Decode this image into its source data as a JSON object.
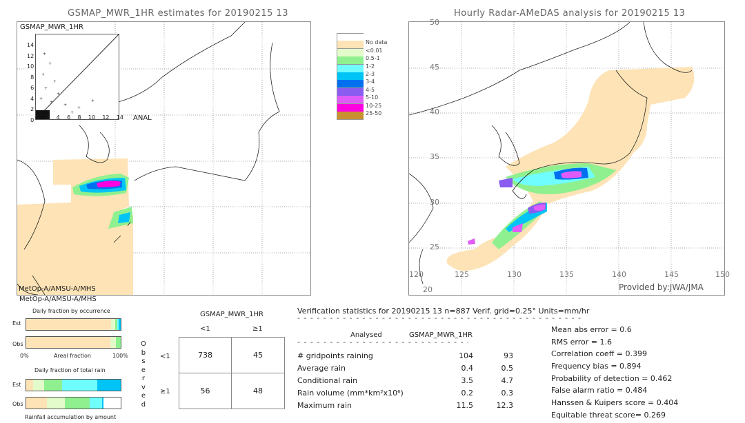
{
  "left_map": {
    "title": "GSMAP_MWR_1HR estimates for 20190215 13",
    "inset_label": "GSMAP_MWR_1HR",
    "inset_xlabel": "ANAL",
    "inset_yticks": [
      "14",
      "12",
      "10",
      "8",
      "6",
      "4",
      "2",
      "0"
    ],
    "inset_xticks": [
      "0",
      "2",
      "4",
      "6",
      "8",
      "10",
      "12",
      "14"
    ],
    "satellite": "MetOp-A/AMSU-A/MHS"
  },
  "right_map": {
    "title": "Hourly Radar-AMeDAS analysis for 20190215 13",
    "lat_ticks": [
      "50",
      "45",
      "40",
      "35",
      "30",
      "25",
      "20"
    ],
    "lon_ticks": [
      "120",
      "125",
      "130",
      "135",
      "140",
      "145",
      "150"
    ],
    "credit": "Provided by:JWA/JMA"
  },
  "legend": {
    "items": [
      {
        "label": "",
        "color": "#ffffff"
      },
      {
        "label": "No data",
        "color": "#fde3b5"
      },
      {
        "label": "<0.01",
        "color": "#e3fbcb"
      },
      {
        "label": "0.5-1",
        "color": "#8ff08f"
      },
      {
        "label": "1-2",
        "color": "#6ffdfd"
      },
      {
        "label": "2-3",
        "color": "#00c4f5"
      },
      {
        "label": "3-4",
        "color": "#0070f0"
      },
      {
        "label": "4-5",
        "color": "#8a5cf0"
      },
      {
        "label": "5-10",
        "color": "#e05cf8"
      },
      {
        "label": "10-25",
        "color": "#ff00e0"
      },
      {
        "label": "25-50",
        "color": "#c89030"
      }
    ]
  },
  "fractions": {
    "satellite": "MetOp-A/AMSU-A/MHS",
    "occurrence_title": "Daily fraction by occurrence",
    "est": "Est",
    "obs": "Obs",
    "axis_left": "0%",
    "axis_mid": "Areal fraction",
    "axis_right": "100%",
    "rain_title": "Daily fraction of total rain",
    "rain_footer": "Rainfall accumulation by amount",
    "occ_est": [
      {
        "c": "#fde3b5",
        "v": 90
      },
      {
        "c": "#e3fbcb",
        "v": 4
      },
      {
        "c": "#8ff08f",
        "v": 2
      },
      {
        "c": "#6ffdfd",
        "v": 2
      },
      {
        "c": "#00c4f5",
        "v": 2
      }
    ],
    "occ_obs": [
      {
        "c": "#fde3b5",
        "v": 89
      },
      {
        "c": "#e3fbcb",
        "v": 6
      },
      {
        "c": "#8ff08f",
        "v": 5
      }
    ],
    "rain_est": [
      {
        "c": "#fde3b5",
        "v": 7
      },
      {
        "c": "#e3fbcb",
        "v": 12
      },
      {
        "c": "#8ff08f",
        "v": 19
      },
      {
        "c": "#6ffdfd",
        "v": 37
      },
      {
        "c": "#00c4f5",
        "v": 25
      }
    ],
    "rain_obs": [
      {
        "c": "#fde3b5",
        "v": 22
      },
      {
        "c": "#e3fbcb",
        "v": 19
      },
      {
        "c": "#8ff08f",
        "v": 26
      },
      {
        "c": "#6ffdfd",
        "v": 13
      },
      {
        "c": "#00c4f5",
        "v": 2
      }
    ]
  },
  "contingency": {
    "title": "GSMAP_MWR_1HR",
    "col_lt": "<1",
    "col_ge": "≥1",
    "row_lt": "<1",
    "row_ge": "≥1",
    "observed": [
      "O",
      "b",
      "s",
      "e",
      "r",
      "v",
      "e",
      "d"
    ],
    "cells": [
      [
        "738",
        "45"
      ],
      [
        "56",
        "48"
      ]
    ]
  },
  "stats": {
    "header": "Verification statistics for 20190215 13  n=887  Verif. grid=0.25°  Units=mm/hr",
    "col_analysed": "Analysed",
    "col_est": "GSMAP_MWR_1HR",
    "rows": [
      {
        "label": "# gridpoints raining",
        "a": "104",
        "e": "93"
      },
      {
        "label": "Average rain",
        "a": "0.4",
        "e": "0.5"
      },
      {
        "label": "Conditional rain",
        "a": "3.5",
        "e": "4.7"
      },
      {
        "label": "Rain volume (mm*km²x10⁶)",
        "a": "0.2",
        "e": "0.3"
      },
      {
        "label": "Maximum rain",
        "a": "11.5",
        "e": "12.3"
      }
    ],
    "scores": [
      "Mean abs error = 0.6",
      "RMS error = 1.6",
      "Correlation coeff = 0.399",
      "Frequency bias = 0.894",
      "Probability of detection = 0.462",
      "False alarm ratio = 0.484",
      "Hanssen & Kuipers score = 0.404",
      "Equitable threat score= 0.269"
    ]
  }
}
